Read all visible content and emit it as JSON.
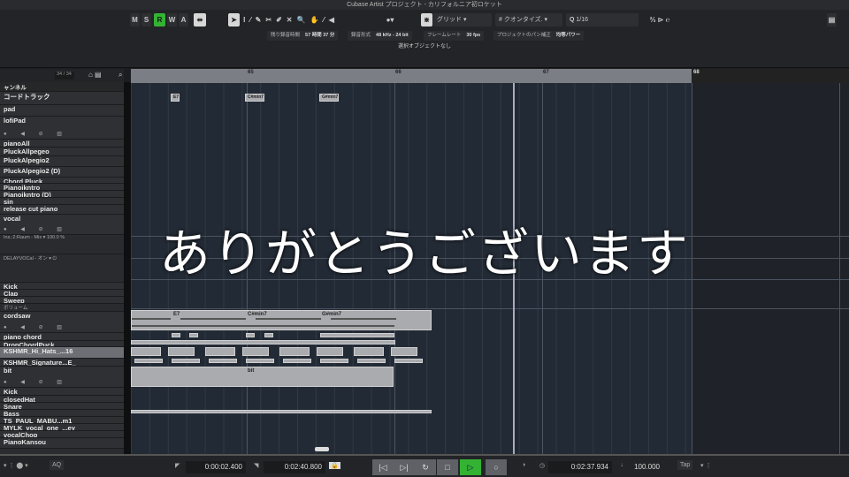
{
  "window": {
    "title": "Cubase Artist プロジェクト - カリフォルニア初ロケット"
  },
  "toolbar": {
    "m": "M",
    "s": "S",
    "r": "R",
    "w": "W",
    "a": "A",
    "snap_type": "グリッド",
    "quantize_label": "クオンタイズ.",
    "quantize_q": "Q",
    "quantize_value": "1/16"
  },
  "info": {
    "rec_time_label": "残り録音時間",
    "rec_time": "57 時間 37 分",
    "format_label": "録音形式",
    "format": "48 kHz - 24 bit",
    "frame_label": "フレームレート",
    "frame": "30 fps",
    "pan_label": "プロジェクトのパン補正",
    "pan": "均等パワー"
  },
  "status": "選択オブジェクトなし",
  "tracklist": {
    "count": "34 / 34",
    "header": "ャンネル",
    "tracks": [
      {
        "name": "コードトラック"
      },
      {
        "name": "pad"
      },
      {
        "name": "lofiPad",
        "buttons": "● ◀ ⊘ ▥"
      },
      {
        "name": "pianoAll"
      },
      {
        "name": "PluckAllpegeo"
      },
      {
        "name": "PluckAlpegio2"
      },
      {
        "name": "PluckAlpegio2 (D)"
      },
      {
        "name": "Chord Pluck"
      },
      {
        "name": "Pianoikntro"
      },
      {
        "name": "Pianoikntro (D)"
      },
      {
        "name": "sin"
      },
      {
        "name": "release cut piano"
      },
      {
        "name": "vocal",
        "buttons": "● ◀ ⊘ ▥"
      },
      {
        "name": "Ins.:2:Raum - Mix   ▾   100.0 %"
      },
      {
        "name": "DELAYVOCal - オン  ▾  ⏻"
      },
      {
        "name": "Kick"
      },
      {
        "name": "Clap"
      },
      {
        "name": "Sweep"
      },
      {
        "name": "ボリューム"
      },
      {
        "name": "cordsaw",
        "buttons": "● ◀ ⊘ ▥"
      },
      {
        "name": "piano chord"
      },
      {
        "name": "DropChordPuck"
      },
      {
        "name": "KSHMR_Hi_Hats_...16"
      },
      {
        "name": "KSHMR_Signature...E_"
      },
      {
        "name": "bit",
        "buttons": "● ◀ ⊘ ▥"
      },
      {
        "name": "Kick"
      },
      {
        "name": "closedHat"
      },
      {
        "name": "Snare"
      },
      {
        "name": "Bass"
      },
      {
        "name": "TS_PAUL_MABU...m1"
      },
      {
        "name": "MYLK_vocal_one_...ey"
      },
      {
        "name": "vocalChop"
      },
      {
        "name": "PianoKansou"
      }
    ]
  },
  "ruler": {
    "bars": [
      "65",
      "66",
      "67",
      "68"
    ]
  },
  "chords": [
    "E7",
    "C#min7",
    "G#min7"
  ],
  "events": {
    "cordsaw": [
      "E7",
      "C#min7",
      "G#min7"
    ],
    "bit": "bit"
  },
  "overlay": "ありがとうございます",
  "transport": {
    "left_locator": "0:00:02.400",
    "right_locator": "0:02:40.800",
    "position": "0:02:37.934",
    "tempo": "100.000",
    "tap": "Tap",
    "aq": "AQ"
  },
  "colors": {
    "record": "#34b233",
    "play": "#34b233",
    "background": "#222a35"
  }
}
